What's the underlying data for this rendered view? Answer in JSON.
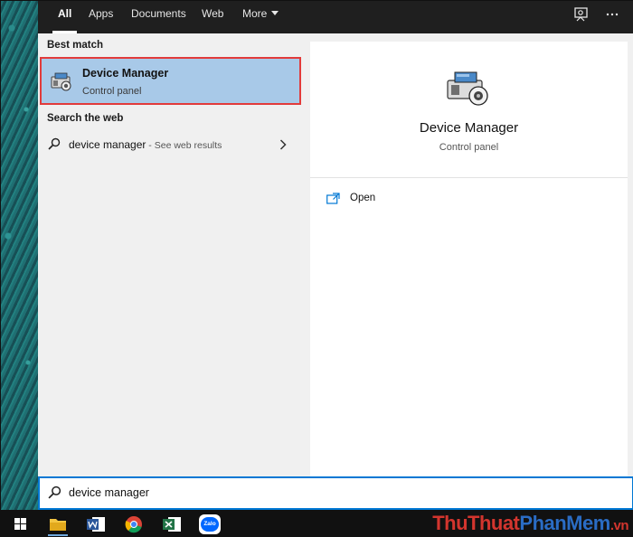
{
  "tabs": [
    {
      "label": "All",
      "active": true
    },
    {
      "label": "Apps"
    },
    {
      "label": "Documents"
    },
    {
      "label": "Web"
    },
    {
      "label": "More"
    }
  ],
  "topbar_icons": [
    "feedback-icon",
    "more-options-icon"
  ],
  "best_match": {
    "header": "Best match",
    "title": "Device Manager",
    "subtitle": "Control panel"
  },
  "search_web": {
    "header": "Search the web",
    "query": "device manager",
    "suffix": " - See web results"
  },
  "preview": {
    "title": "Device Manager",
    "subtitle": "Control panel",
    "actions": [
      {
        "label": "Open",
        "icon": "open-icon"
      }
    ]
  },
  "search_box": {
    "value": "device manager"
  },
  "taskbar": {
    "apps": [
      "windows-start-icon",
      "file-explorer-icon",
      "word-icon",
      "chrome-icon",
      "excel-icon",
      "zalo-icon"
    ],
    "zalo_label": "Zalo"
  },
  "watermark": {
    "part1": "ThuThuat",
    "part2": "PhanMem",
    "part3": ".vn"
  },
  "colors": {
    "accent": "#0078d4",
    "selection_bg": "#a8c9e8",
    "highlight_border": "#e23b3b",
    "topbar_bg": "#1f1f1f"
  }
}
